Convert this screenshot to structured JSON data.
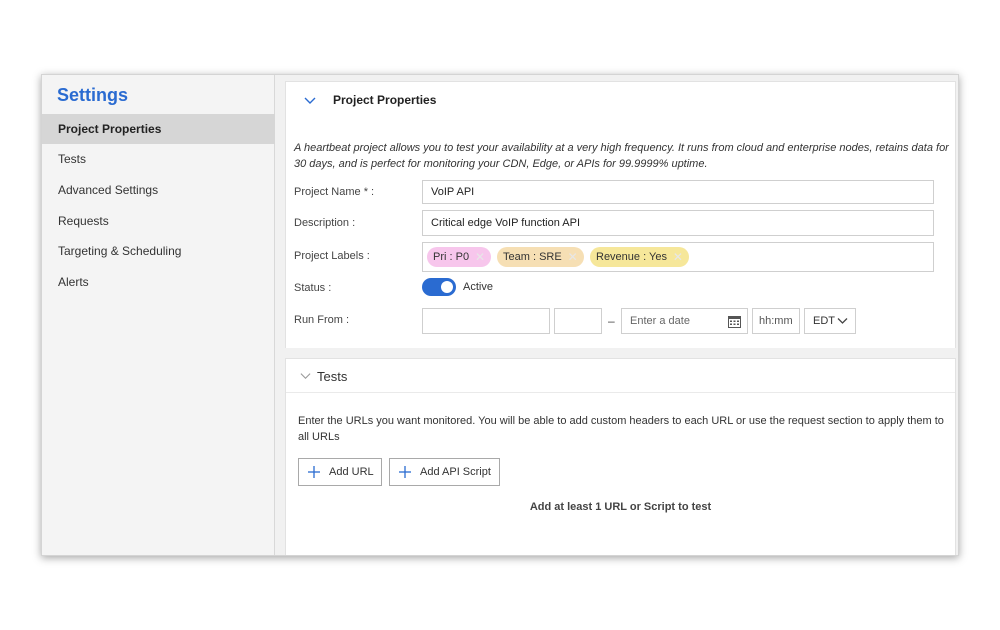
{
  "sidebar": {
    "title": "Settings",
    "items": [
      {
        "label": "Project Properties",
        "active": true
      },
      {
        "label": "Tests"
      },
      {
        "label": "Advanced Settings"
      },
      {
        "label": "Requests"
      },
      {
        "label": "Targeting & Scheduling"
      },
      {
        "label": "Alerts"
      }
    ]
  },
  "project": {
    "section_title": "Project Properties",
    "intro": "A heartbeat project allows you to test your availability at a very high frequency. It runs from cloud and enterprise nodes, retains data for 30 days, and is perfect for monitoring your CDN, Edge, or APIs for 99.9999% uptime.",
    "name_label": "Project Name * :",
    "name_value": "VoIP API",
    "description_label": "Description :",
    "description_value": "Critical edge VoIP function API",
    "labels_label": "Project Labels :",
    "labels": [
      {
        "text": "Pri : P0",
        "color": "#f7c6ec"
      },
      {
        "text": "Team : SRE",
        "color": "#f6dfb4"
      },
      {
        "text": "Revenue : Yes",
        "color": "#f6e79a"
      }
    ],
    "status_label": "Status :",
    "status_value": "Active",
    "run_from_label": "Run From :",
    "run_from_separator": "–",
    "date_placeholder": "Enter a date",
    "time_placeholder": "hh:mm",
    "timezone": "EDT"
  },
  "tests": {
    "section_title": "Tests",
    "description": "Enter the URLs you want monitored. You will be able to add custom headers to each URL or use the request section to apply them to all URLs",
    "add_url_label": "Add URL",
    "add_script_label": "Add API Script",
    "hint": "Add at least 1 URL or Script to test"
  },
  "colors": {
    "accent": "#2a6bd1",
    "active_nav_bg": "#d6d6d6"
  }
}
